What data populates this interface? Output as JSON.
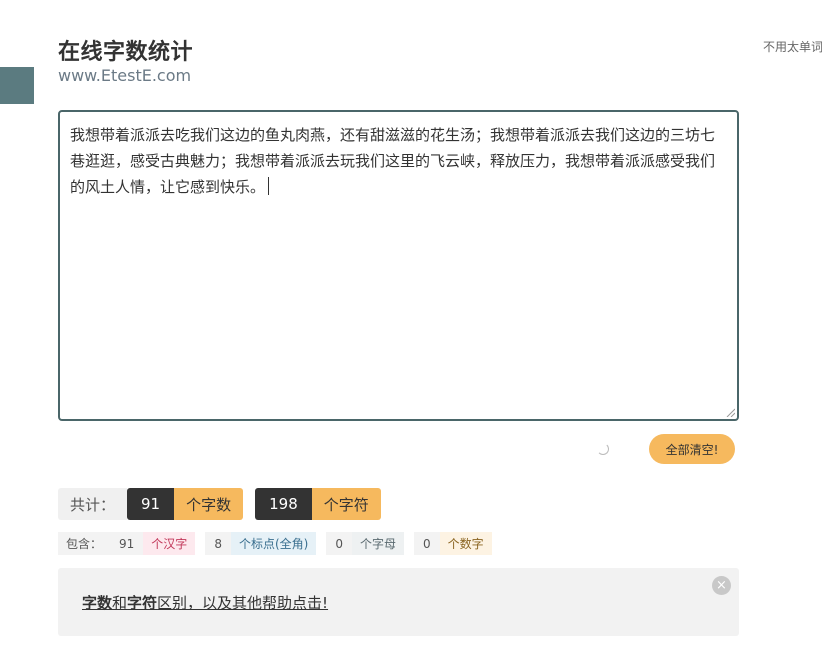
{
  "header": {
    "title": "在线字数统计",
    "subtitle": "www.EtestE.com",
    "side_note": "不用太单词"
  },
  "editor": {
    "text": "我想带着派派去吃我们这边的鱼丸肉燕，还有甜滋滋的花生汤；我想带着派派去我们这边的三坊七巷逛逛，感受古典魅力；我想带着派派去玩我们这里的飞云峡，释放压力，我想带着派派感受我们的风土人情，让它感到快乐。"
  },
  "actions": {
    "clear_label": "全部清空!"
  },
  "totals": {
    "label": "共计：",
    "word_count": "91",
    "word_unit": "个字数",
    "char_count": "198",
    "char_unit": "个字符"
  },
  "breakdown": {
    "label": "包含：",
    "han_count": "91",
    "han_unit": "个汉字",
    "punct_count": "8",
    "punct_unit": "个标点(全角)",
    "letter_count": "0",
    "letter_unit": "个字母",
    "digit_count": "0",
    "digit_unit": "个数字"
  },
  "help": {
    "bold1": "字数",
    "mid1": "和",
    "bold2": "字符",
    "rest": "区别，以及其他帮助点击!",
    "close_glyph": "×"
  },
  "colors": {
    "accent_orange": "#f6b95e",
    "dark": "#333333",
    "border_teal": "#4a6669",
    "side_tab": "#5b7b80"
  }
}
